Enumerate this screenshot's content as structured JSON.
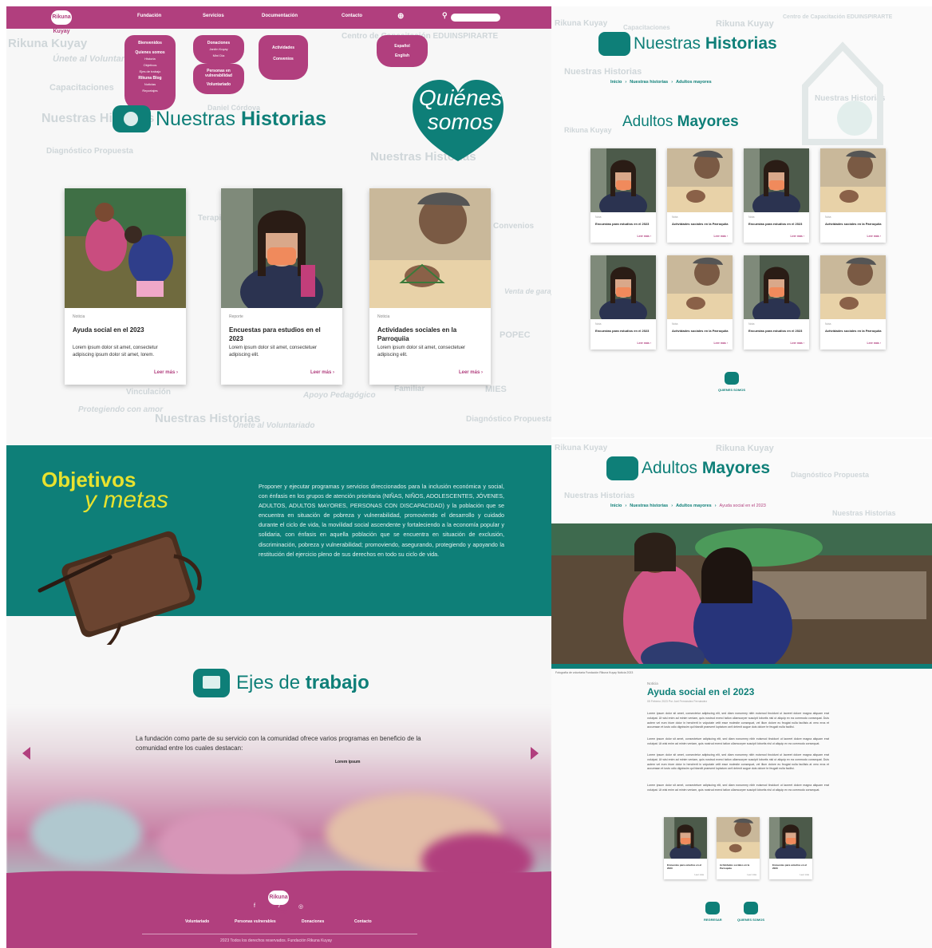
{
  "nav": {
    "logo_text": "Rikuna Kuyay",
    "items": [
      "Fundación",
      "Servicios",
      "Documentación",
      "Contacto"
    ],
    "globe_icon": "globe-icon",
    "search_icon": "search-icon",
    "search_placeholder": ""
  },
  "dropdowns": {
    "fundacion": {
      "header": "Bienvenidos",
      "items": [
        "Quienes somos",
        "Historia",
        "Objetivos",
        "Ejes de trabajo",
        "Rikuna Blog",
        "Noticias",
        "Reportajes"
      ]
    },
    "servicios_a": {
      "header": "Donaciones",
      "items": [
        "Jardín Kuyay",
        "Mini Día"
      ]
    },
    "servicios_b": {
      "header": "Personas en vulnerabilidad",
      "items": [
        "Voluntariado"
      ]
    },
    "actividades": {
      "header": "Actividades",
      "items": [
        "Convenios"
      ]
    },
    "idiomas": {
      "items": [
        "Español",
        "English"
      ]
    }
  },
  "hero": {
    "title_light": "Nuestras",
    "title_bold": "Historias",
    "heart_line1": "Quiénes",
    "heart_line2": "somos"
  },
  "stories": [
    {
      "category": "Noticia",
      "title": "Ayuda social en el 2023",
      "text": "Lorem ipsum dolor sit amet, consectetur adipiscing ipsum dolor sit amet, lorem.",
      "more": "Leer más"
    },
    {
      "category": "Reporte",
      "title": "Encuestas para estudios en el 2023",
      "text": "Lorem ipsum dolor sit amet, consectetuer adipiscing elit.",
      "more": "Leer más"
    },
    {
      "category": "Noticia",
      "title": "Actividades sociales en la Parroquiia",
      "text": "Lorem ipsum dolor sit amet, consectetuer adipiscing elit.",
      "more": "Leer más"
    }
  ],
  "objetivos": {
    "title": "Objetivos",
    "subtitle": "y metas",
    "text": "Proponer y ejecutar programas y servicios direccionados para la inclusión económica y social, con énfasis en los grupos de atención prioritaria (NIÑAS, NIÑOS, ADOLESCENTES, JÓVENES, ADULTOS, ADULTOS MAYORES, PERSONAS CON DISCAPACIDAD) y la población que se encuentra en situación de pobreza y vulnerabilidad, promoviendo el desarrollo y cuidado durante el ciclo de vida, la movilidad social ascendente y fortaleciendo a la economía popular y solidaria, con énfasis en aquella población que se encuentra en situación de exclusión, discriminación, pobreza y vulnerabilidad; promoviendo, asegurando, protegiendo y apoyando la restitución del ejercicio pleno de sus derechos en todo su ciclo de vida."
  },
  "ejes": {
    "title_light": "Ejes de",
    "title_bold": "trabajo",
    "text": "La fundación como parte de su servicio con la comunidad ofrece varios programas en beneficio de la comunidad entre los cuales destacan:",
    "slide_label": "Lorem ipsum"
  },
  "footer": {
    "logo_text": "Rikuna Kuyay",
    "social": [
      "f",
      "♪",
      "◎"
    ],
    "links": [
      "Voluntariado",
      "Personas vulnerables",
      "Donaciones",
      "Contacto"
    ],
    "copyright": "2023 Todos los derechos reservados. Fundación Rikuna Kuyay"
  },
  "page2": {
    "title_light": "Nuestras",
    "title_bold": "Historias",
    "breadcrumb": [
      "Inicio",
      "Nuestras historias",
      "Adultos mayores"
    ],
    "section_light": "Adultos",
    "section_bold": "Mayores",
    "cards": [
      {
        "category": "Nota",
        "title": "Encuestas para estudios en el 2023",
        "more": "Leer más"
      },
      {
        "category": "Nota",
        "title": "Actividades sociales en la Parroquiia",
        "more": "Leer más"
      },
      {
        "category": "Nota",
        "title": "Encuestas para estudios en el 2023",
        "more": "Leer más"
      },
      {
        "category": "Nota",
        "title": "Actividades sociales en la Parroquiia",
        "more": "Leer más"
      },
      {
        "category": "Nota",
        "title": "Encuestas para estudios en el 2023",
        "more": "Leer más"
      },
      {
        "category": "Nota",
        "title": "Actividades sociales en la Parroquiia",
        "more": "Leer más"
      },
      {
        "category": "Nota",
        "title": "Encuestas para estudios en el 2023",
        "more": "Leer más"
      },
      {
        "category": "Nota",
        "title": "Actividades sociales en la Parroquiia",
        "more": "Leer más"
      }
    ],
    "quienes": "QUIENES SOMOS"
  },
  "page3": {
    "title_light": "Adultos",
    "title_bold": "Mayores",
    "breadcrumb": [
      "Inicio",
      "Nuestras historias",
      "Adultos mayores"
    ],
    "breadcrumb_current": "Ayuda social en el 2023",
    "photo_caption": "Fotografía de voluntaria Fundación Rikuna Kuyay Noticia 2023",
    "category": "Noticia",
    "title": "Ayuda social en el 2023",
    "date": "05 Febrero 2023 Por Joel Fernández Fernández",
    "paragraphs": [
      "Lorem ipsum dolor sit amet, consectetur adipiscing elit, sed diam nonummy nibh euismod tincidunt ut laoreet dolore magna aliquam erat volutpat. Ut wisi enim ad minim veniam, quis nostrud exerci tation ullamcorper suscipit lobortis nisl ut aliquip ex ea commodo consequat. Duis autem vel eum iriure dolor in hendrerit in vulputate velit esse molestie consequat, vel illum dolore eu feugiat nulla facilisis at vero eros et accumsan et iusto odio dignissim qui blandit praesent luptatum zzril delenit augue duis dolore te feugait nulla facilisi.",
      "Lorem ipsum dolor sit amet, consectetuer adipiscing elit, sed diam nonummy nibh euismod tincidunt ut laoreet dolore magna aliquam erat volutpat. Ut wisi enim ad minim veniam, quis nostrud exerci tation ullamcorper suscipit lobortis nisl ut aliquip ex ea commodo consequat.",
      "Lorem ipsum dolor sit amet, consectetur adipiscing elit, sed diam nonummy nibh euismod tincidunt ut laoreet dolore magna aliquam erat volutpat. Ut wisi enim ad minim veniam, quis nostrud exerci tation ullamcorper suscipit lobortis nisl ut aliquip ex ea commodo consequat. Duis autem vel eum iriure dolor in hendrerit in vulputate velit esse molestie consequat, vel illum dolore eu feugiat nulla facilisis at vero eros et accumsan et iusto odio dignissim qui blandit praesent luptatum zzril delenit augue duis dolore te feugait nulla facilisi.",
      "Lorem ipsum dolor sit amet, consectetuer adipiscing elit, sed diam nonummy nibh euismod tincidunt ut laoreet dolore magna aliquam erat volutpat. Ut wisi enim ad minim veniam, quis nostrud exerci tation ullamcorper suscipit lobortis nisl ut aliquip ex ea commodo consequat."
    ],
    "related": [
      {
        "title": "Encuestas para estudios en el 2023",
        "more": "Leer más"
      },
      {
        "title": "Actividades sociales en la Parroquiia",
        "more": "Leer más"
      },
      {
        "title": "Encuestas para estudios en el 2023",
        "more": "Leer más"
      }
    ],
    "back": "REGRESAR",
    "quienes": "QUIENES SOMOS"
  },
  "watermarks": [
    "Rikuna Kuyay",
    "Únete al Voluntariado",
    "Capacitaciones",
    "Nuestras Historias",
    "Diagnóstico Propuesta",
    "Protegiendo con amor",
    "Centro de Capacitación EDUINSPIRARTE",
    "Terapia Psicológica Integral",
    "Apoyo Pedagógico",
    "MIES",
    "POPEC",
    "Daniel Córdova",
    "Venta de garaje",
    "Vinculación",
    "Familiar",
    "Convenios"
  ],
  "colors": {
    "brand_pink": "#b13f7e",
    "brand_teal": "#0e7f78",
    "accent_yellow": "#e8e22e"
  }
}
